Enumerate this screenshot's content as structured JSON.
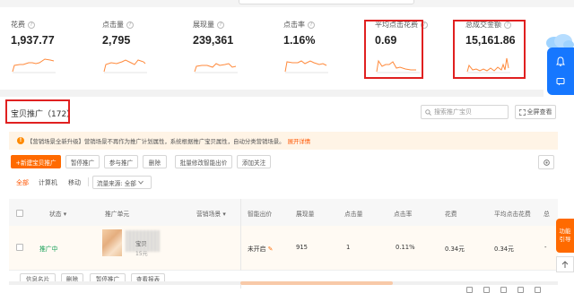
{
  "metrics": [
    {
      "key": "spend",
      "label": "花费",
      "value": "1,937.77"
    },
    {
      "key": "clicks",
      "label": "点击量",
      "value": "2,795"
    },
    {
      "key": "impressions",
      "label": "展现量",
      "value": "239,361"
    },
    {
      "key": "ctr",
      "label": "点击率",
      "value": "1.16%"
    },
    {
      "key": "cpc",
      "label": "平均点击花费",
      "value": "0.69"
    },
    {
      "key": "gmv",
      "label": "总成交金额",
      "value": "15,161.86"
    }
  ],
  "section": {
    "title": "宝贝推广（172）"
  },
  "search": {
    "placeholder": "搜索推广宝贝"
  },
  "fullscreen_label": "全屏查看",
  "notice": {
    "text": "【营销场景全新升级】营销场景不再作为推广计划属性，系统根据推广宝贝属性，自动分类营销场景。",
    "link": "展开详情"
  },
  "toolbar": {
    "new_label": "+新建宝贝推广",
    "pause_label": "暂停推广",
    "resume_label": "参与推广",
    "delete_label": "删除",
    "bid_label": "批量修改智能出价",
    "follow_label": "添加关注"
  },
  "filters": {
    "all": "全部",
    "pc": "计算机",
    "mobile": "移动",
    "source_label": "流量来源: 全部"
  },
  "table": {
    "headers": {
      "status": "状态",
      "unit": "推广单元",
      "scene": "营销场景",
      "smart_bid": "智能出价",
      "impressions": "展现量",
      "clicks": "点击量",
      "ctr": "点击率",
      "spend": "花费",
      "cpc": "平均点击花费",
      "extra": "总"
    },
    "rows": [
      {
        "status": "推广中",
        "product_name": "宝贝",
        "product_price": "15元",
        "smart_bid": "未开启",
        "impressions": "915",
        "clicks": "1",
        "ctr": "0.11%",
        "spend": "0.34元",
        "cpc": "0.34元",
        "extra": "-"
      }
    ]
  },
  "row_actions": {
    "copy": "信息名片",
    "delete": "删除",
    "pause": "暂停推广",
    "report": "查看报表"
  },
  "side_help_label": "功能引导",
  "colors": {
    "accent": "#ff6a00",
    "highlight": "#e02020",
    "panel": "#1677ff",
    "status_on": "#18a058"
  }
}
